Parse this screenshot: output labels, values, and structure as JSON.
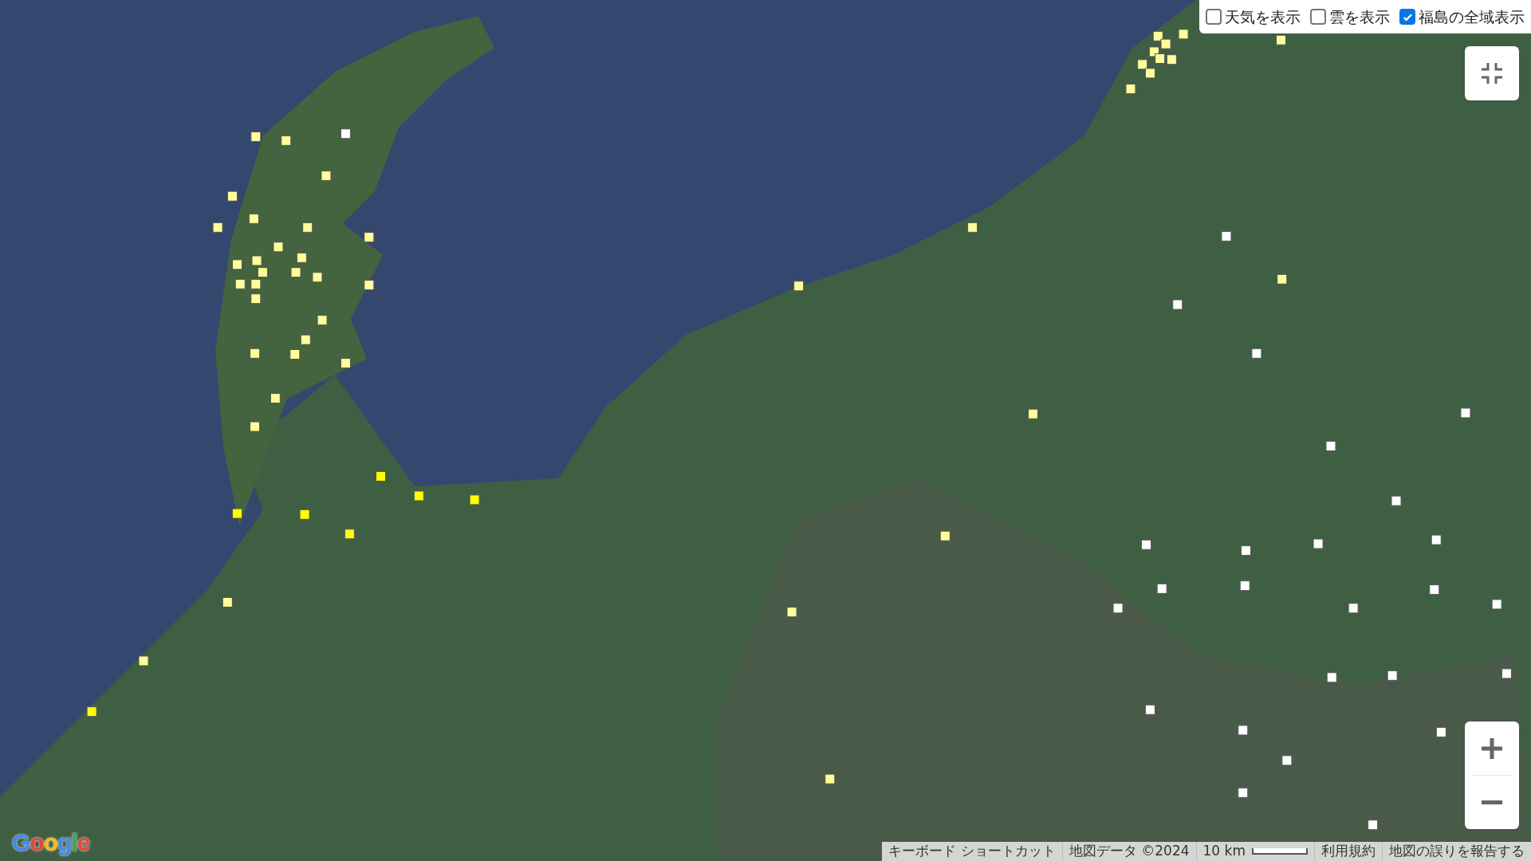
{
  "layers": [
    {
      "label": "天気を表示",
      "checked": false
    },
    {
      "label": "雲を表示",
      "checked": false
    },
    {
      "label": "福島の全域表示",
      "checked": true
    }
  ],
  "logo": "Google",
  "attribution": [
    {
      "kind": "link",
      "label": "キーボード ショートカット"
    },
    {
      "kind": "text",
      "label": "地図データ ©2024"
    },
    {
      "kind": "scale",
      "label": "10 km"
    },
    {
      "kind": "link",
      "label": "利用規約"
    },
    {
      "kind": "link",
      "label": "地図の誤りを報告する"
    }
  ]
}
